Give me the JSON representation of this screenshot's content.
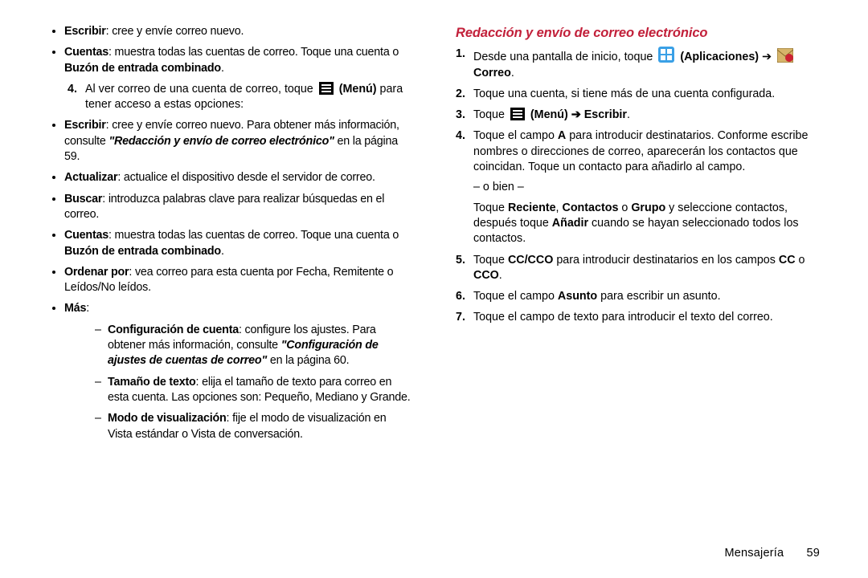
{
  "left": {
    "bul_escribir_label": "Escribir",
    "bul_escribir_rest": ": cree y envíe correo nuevo.",
    "bul_cuentas_label": "Cuentas",
    "bul_cuentas_rest_a": ": muestra todas las cuentas de correo. Toque una cuenta o ",
    "bul_cuentas_rest_b": "Buzón de entrada combinado",
    "bul_cuentas_rest_c": ".",
    "num4_a": "Al ver correo de una cuenta de correo, toque ",
    "num4_b": "(Menú)",
    "num4_c": " para tener acceso a estas opciones:",
    "s_escribir_lbl": "Escribir",
    "s_escribir_a": ": cree y envíe correo nuevo. Para obtener más información, consulte ",
    "s_escribir_ref": "\"Redacción y envío de correo electrónico\"",
    "s_escribir_pg": " en la página 59.",
    "s_actualizar_lbl": "Actualizar",
    "s_actualizar_a": ": actualice el dispositivo desde el servidor de correo.",
    "s_buscar_lbl": "Buscar",
    "s_buscar_a": ": introduzca palabras clave para realizar búsquedas en el correo.",
    "s_cuentas_lbl": "Cuentas",
    "s_cuentas_a": ": muestra todas las cuentas de correo. Toque una cuenta o ",
    "s_cuentas_b": "Buzón de entrada combinado",
    "s_cuentas_c": ".",
    "s_ordenar_lbl": "Ordenar por",
    "s_ordenar_a": ": vea correo para esta cuenta por Fecha, Remitente o Leídos/No leídos.",
    "s_mas_lbl": "Más",
    "s_mas_colon": ":",
    "d_config_lbl": "Configuración de cuenta",
    "d_config_a": ": configure los ajustes. Para obtener más información, consulte ",
    "d_config_ref": "\"Configuración de ajustes de cuentas de correo\"",
    "d_config_pg": " en la página 60.",
    "d_tam_lbl": "Tamaño de texto",
    "d_tam_a": ": elija el tamaño de texto para correo en esta cuenta. Las opciones son: Pequeño, Mediano y Grande.",
    "d_modo_lbl": "Modo de visualización",
    "d_modo_a": ": fije el modo de visualización en Vista estándar o Vista de conversación."
  },
  "right": {
    "title": "Redacción y envío de correo electrónico",
    "n1_a": "Desde una pantalla de inicio, toque ",
    "n1_apps": "(Aplicaciones)",
    "n1_arrow": " ➔ ",
    "n1_correo": "Correo",
    "n1_dot": ".",
    "n2": "Toque una cuenta, si tiene más de una cuenta configurada.",
    "n3_a": "Toque ",
    "n3_menu": "(Menú)",
    "n3_arrow": " ➔ ",
    "n3_escribir": "Escribir",
    "n3_dot": ".",
    "n4_a": "Toque el campo ",
    "n4_field": "A",
    "n4_b": " para introducir destinatarios. Conforme escribe nombres o direcciones de correo, aparecerán los contactos que coincidan. Toque un contacto para añadirlo al campo.",
    "n4_or": "– o bien –",
    "n4_r_a": "Toque ",
    "n4_r_rec": "Reciente",
    "n4_r_sep1": ", ",
    "n4_r_con": "Contactos",
    "n4_r_sep2": " o ",
    "n4_r_gru": "Grupo",
    "n4_r_b": " y seleccione contactos, después toque ",
    "n4_r_add": "Añadir",
    "n4_r_c": " cuando se hayan seleccionado todos los contactos.",
    "n5_a": "Toque ",
    "n5_cc": "CC/CCO",
    "n5_b": " para introducir destinatarios en los campos ",
    "n5_cc1": "CC",
    "n5_or": " o ",
    "n5_cc2": "CCO",
    "n5_dot": ".",
    "n6_a": "Toque el campo ",
    "n6_asunto": "Asunto",
    "n6_b": " para escribir un asunto.",
    "n7": "Toque el campo de texto para introducir el texto del correo."
  },
  "footer": {
    "section": "Mensajería",
    "page": "59"
  }
}
